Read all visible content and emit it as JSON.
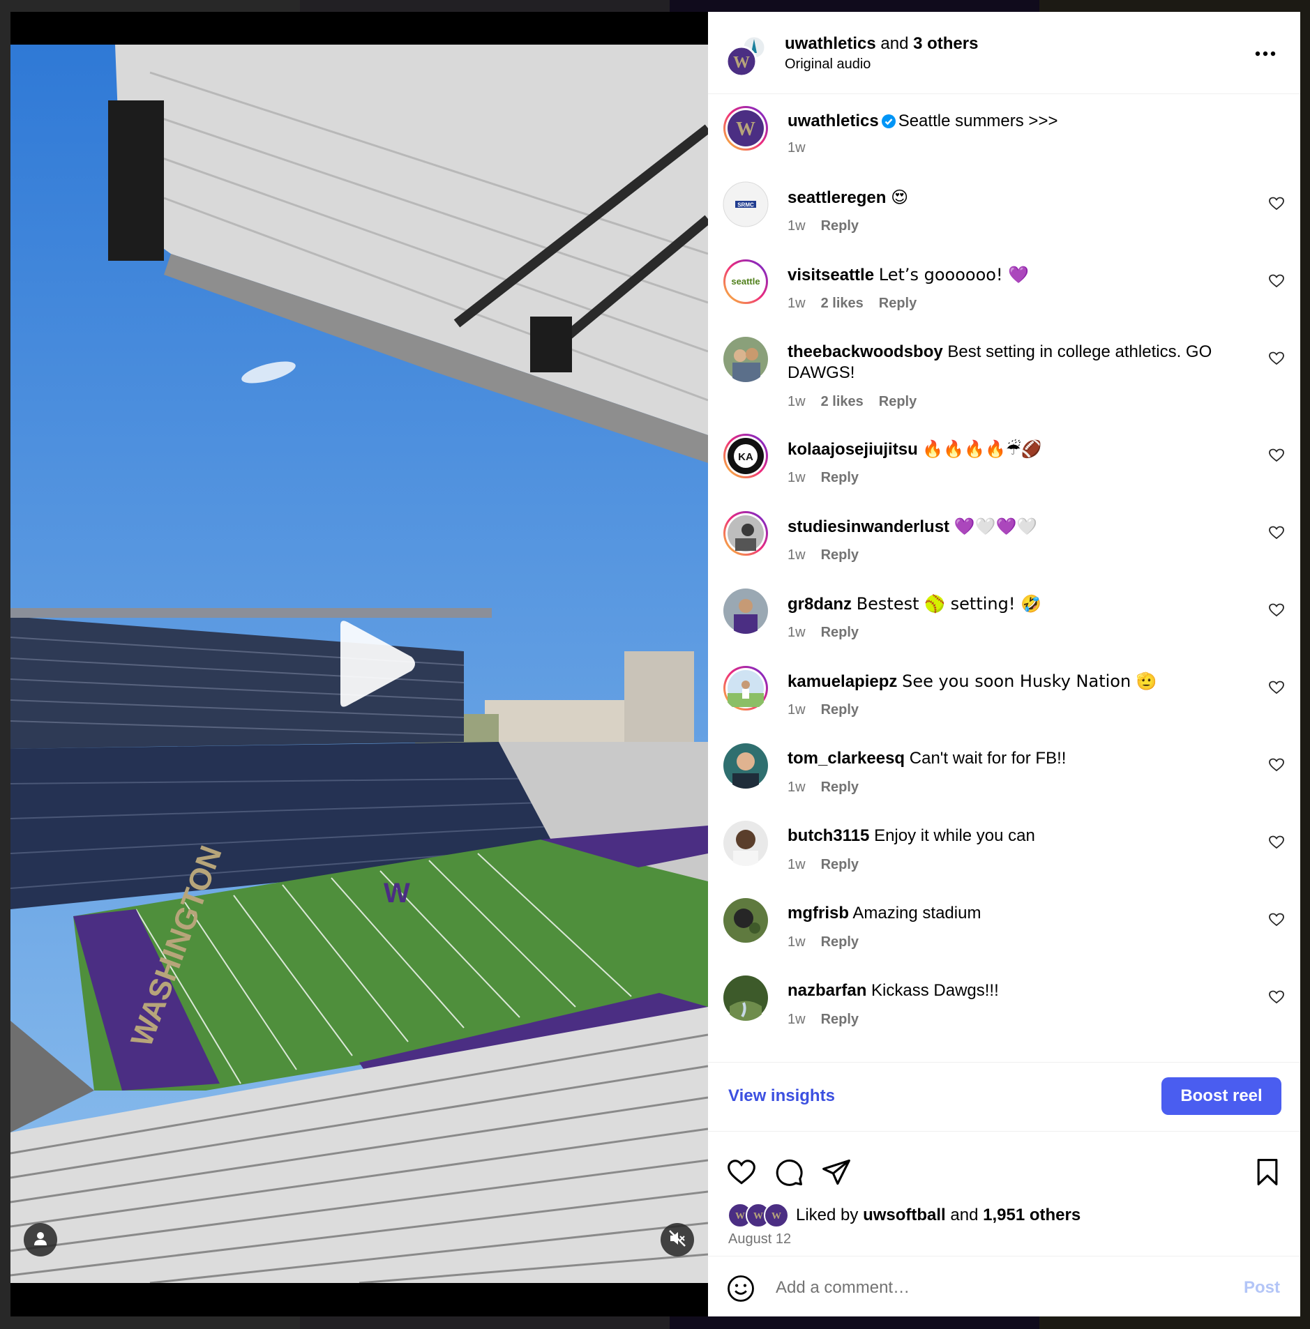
{
  "header": {
    "author": "uwathletics",
    "and_text": "and",
    "others": "3 others",
    "audio": "Original audio",
    "more_icon": "more-horizontal-icon"
  },
  "caption": {
    "user": "uwathletics",
    "verified": true,
    "text": "Seattle summers >>>",
    "time": "1w"
  },
  "comments": [
    {
      "user": "seattleregen",
      "text": "😍",
      "time": "1w",
      "likes": "",
      "reply": "Reply",
      "avatar_text": "SRMC"
    },
    {
      "user": "visitseattle",
      "text": "Let’s goooooo! 💜",
      "time": "1w",
      "likes": "2 likes",
      "reply": "Reply",
      "avatar_text": "seattle"
    },
    {
      "user": "theebackwoodsboy",
      "text": "Best setting in college athletics. GO DAWGS!",
      "time": "1w",
      "likes": "2 likes",
      "reply": "Reply",
      "avatar_text": ""
    },
    {
      "user": "kolaajosejiujitsu",
      "text": "🔥🔥🔥🔥☔🏈",
      "time": "1w",
      "likes": "",
      "reply": "Reply",
      "avatar_text": "KA"
    },
    {
      "user": "studiesinwanderlust",
      "text": "💜🤍💜🤍",
      "time": "1w",
      "likes": "",
      "reply": "Reply",
      "avatar_text": ""
    },
    {
      "user": "gr8danz",
      "text": "Bestest 🥎 setting! 🤣",
      "time": "1w",
      "likes": "",
      "reply": "Reply",
      "avatar_text": ""
    },
    {
      "user": "kamuelapiepz",
      "text": "See you soon Husky Nation 🫡",
      "time": "1w",
      "likes": "",
      "reply": "Reply",
      "avatar_text": ""
    },
    {
      "user": "tom_clarkeesq",
      "text": "Can't wait for for FB!!",
      "time": "1w",
      "likes": "",
      "reply": "Reply",
      "avatar_text": ""
    },
    {
      "user": "butch3115",
      "text": "Enjoy it while you can",
      "time": "1w",
      "likes": "",
      "reply": "Reply",
      "avatar_text": ""
    },
    {
      "user": "mgfrisb",
      "text": "Amazing stadium",
      "time": "1w",
      "likes": "",
      "reply": "Reply",
      "avatar_text": ""
    },
    {
      "user": "nazbarfan",
      "text": "Kickass Dawgs!!!",
      "time": "1w",
      "likes": "",
      "reply": "Reply",
      "avatar_text": ""
    }
  ],
  "insights": {
    "view_label": "View insights",
    "boost_label": "Boost reel"
  },
  "stats": {
    "liked_by_prefix": "Liked by",
    "liked_user": "uwsoftball",
    "and_text": "and",
    "others": "1,951 others",
    "date": "August 12"
  },
  "comment_box": {
    "placeholder": "Add a comment…",
    "post_label": "Post"
  },
  "video": {
    "field_text": "WASHINGTON",
    "logo_letter": "W"
  },
  "colors": {
    "uw_purple": "#4b2e83",
    "uw_gold": "#b7a57a",
    "accent_blue": "#4a5df0",
    "link_blue": "#3c50e0",
    "sky": "#4a90e2",
    "turf": "#4f8f3c"
  }
}
